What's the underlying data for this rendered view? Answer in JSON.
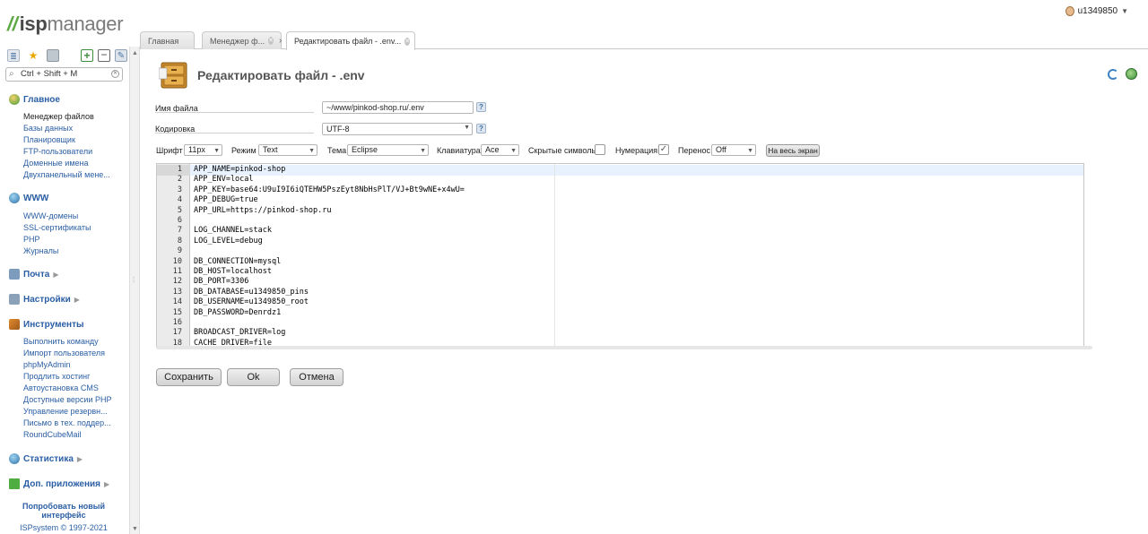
{
  "app": {
    "logo_prefix": "isp",
    "logo_suffix": "manager",
    "user": "u1349850"
  },
  "tabs": [
    {
      "label": "Главная"
    },
    {
      "label": "Менеджер ф..."
    },
    {
      "label": "Редактировать файл - .env..."
    }
  ],
  "sidebar": {
    "search_placeholder": "Ctrl + Shift + M",
    "sections": [
      {
        "label": "Главное",
        "items": [
          "Менеджер файлов",
          "Базы данных",
          "Планировщик",
          "FTP-пользователи",
          "Доменные имена",
          "Двухпанельный мене..."
        ]
      },
      {
        "label": "WWW",
        "items": [
          "WWW-домены",
          "SSL-сертификаты",
          "PHP",
          "Журналы"
        ]
      },
      {
        "label": "Почта",
        "items": []
      },
      {
        "label": "Настройки",
        "items": []
      },
      {
        "label": "Инструменты",
        "items": [
          "Выполнить команду",
          "Импорт пользователя",
          "phpMyAdmin",
          "Продлить хостинг",
          "Автоустановка CMS",
          "Доступные версии PHP",
          "Управление резервн...",
          "Письмо в тех. поддер...",
          "RoundCubeMail"
        ]
      },
      {
        "label": "Статистика",
        "items": []
      },
      {
        "label": "Доп. приложения",
        "items": []
      }
    ],
    "try_new": "Попробовать новый интерфейс",
    "copyright": "ISPsystem © 1997-2021"
  },
  "page": {
    "title": "Редактировать файл - .env",
    "filename_label": "Имя файла",
    "filename_value": "~/www/pinkod-shop.ru/.env",
    "encoding_label": "Кодировка",
    "encoding_value": "UTF-8",
    "help": "?"
  },
  "toolbar": {
    "font_label": "Шрифт",
    "font_value": "11px",
    "mode_label": "Режим",
    "mode_value": "Text",
    "theme_label": "Тема",
    "theme_value": "Eclipse",
    "keyboard_label": "Клавиатура",
    "keyboard_value": "Ace",
    "hidden_label": "Скрытые символы",
    "numbering_label": "Нумерация",
    "wrap_label": "Перенос",
    "wrap_value": "Off",
    "fullscreen_label": "На весь экран"
  },
  "editor": {
    "lines": [
      "APP_NAME=pinkod-shop",
      "APP_ENV=local",
      "APP_KEY=base64:U9uI9I6iQTEHW5PszEyt8NbHsPlT/VJ+Bt9wNE+x4wU=",
      "APP_DEBUG=true",
      "APP_URL=https://pinkod-shop.ru",
      "",
      "LOG_CHANNEL=stack",
      "LOG_LEVEL=debug",
      "",
      "DB_CONNECTION=mysql",
      "DB_HOST=localhost",
      "DB_PORT=3306",
      "DB_DATABASE=u1349850_pins",
      "DB_USERNAME=u1349850_root",
      "DB_PASSWORD=Denrdz1",
      "",
      "BROADCAST_DRIVER=log",
      "CACHE_DRIVER=file"
    ]
  },
  "buttons": {
    "save": "Сохранить",
    "ok": "Ok",
    "cancel": "Отмена"
  },
  "colors": {
    "link": "#2a5ea4",
    "logo_accent": "#5ea843"
  }
}
